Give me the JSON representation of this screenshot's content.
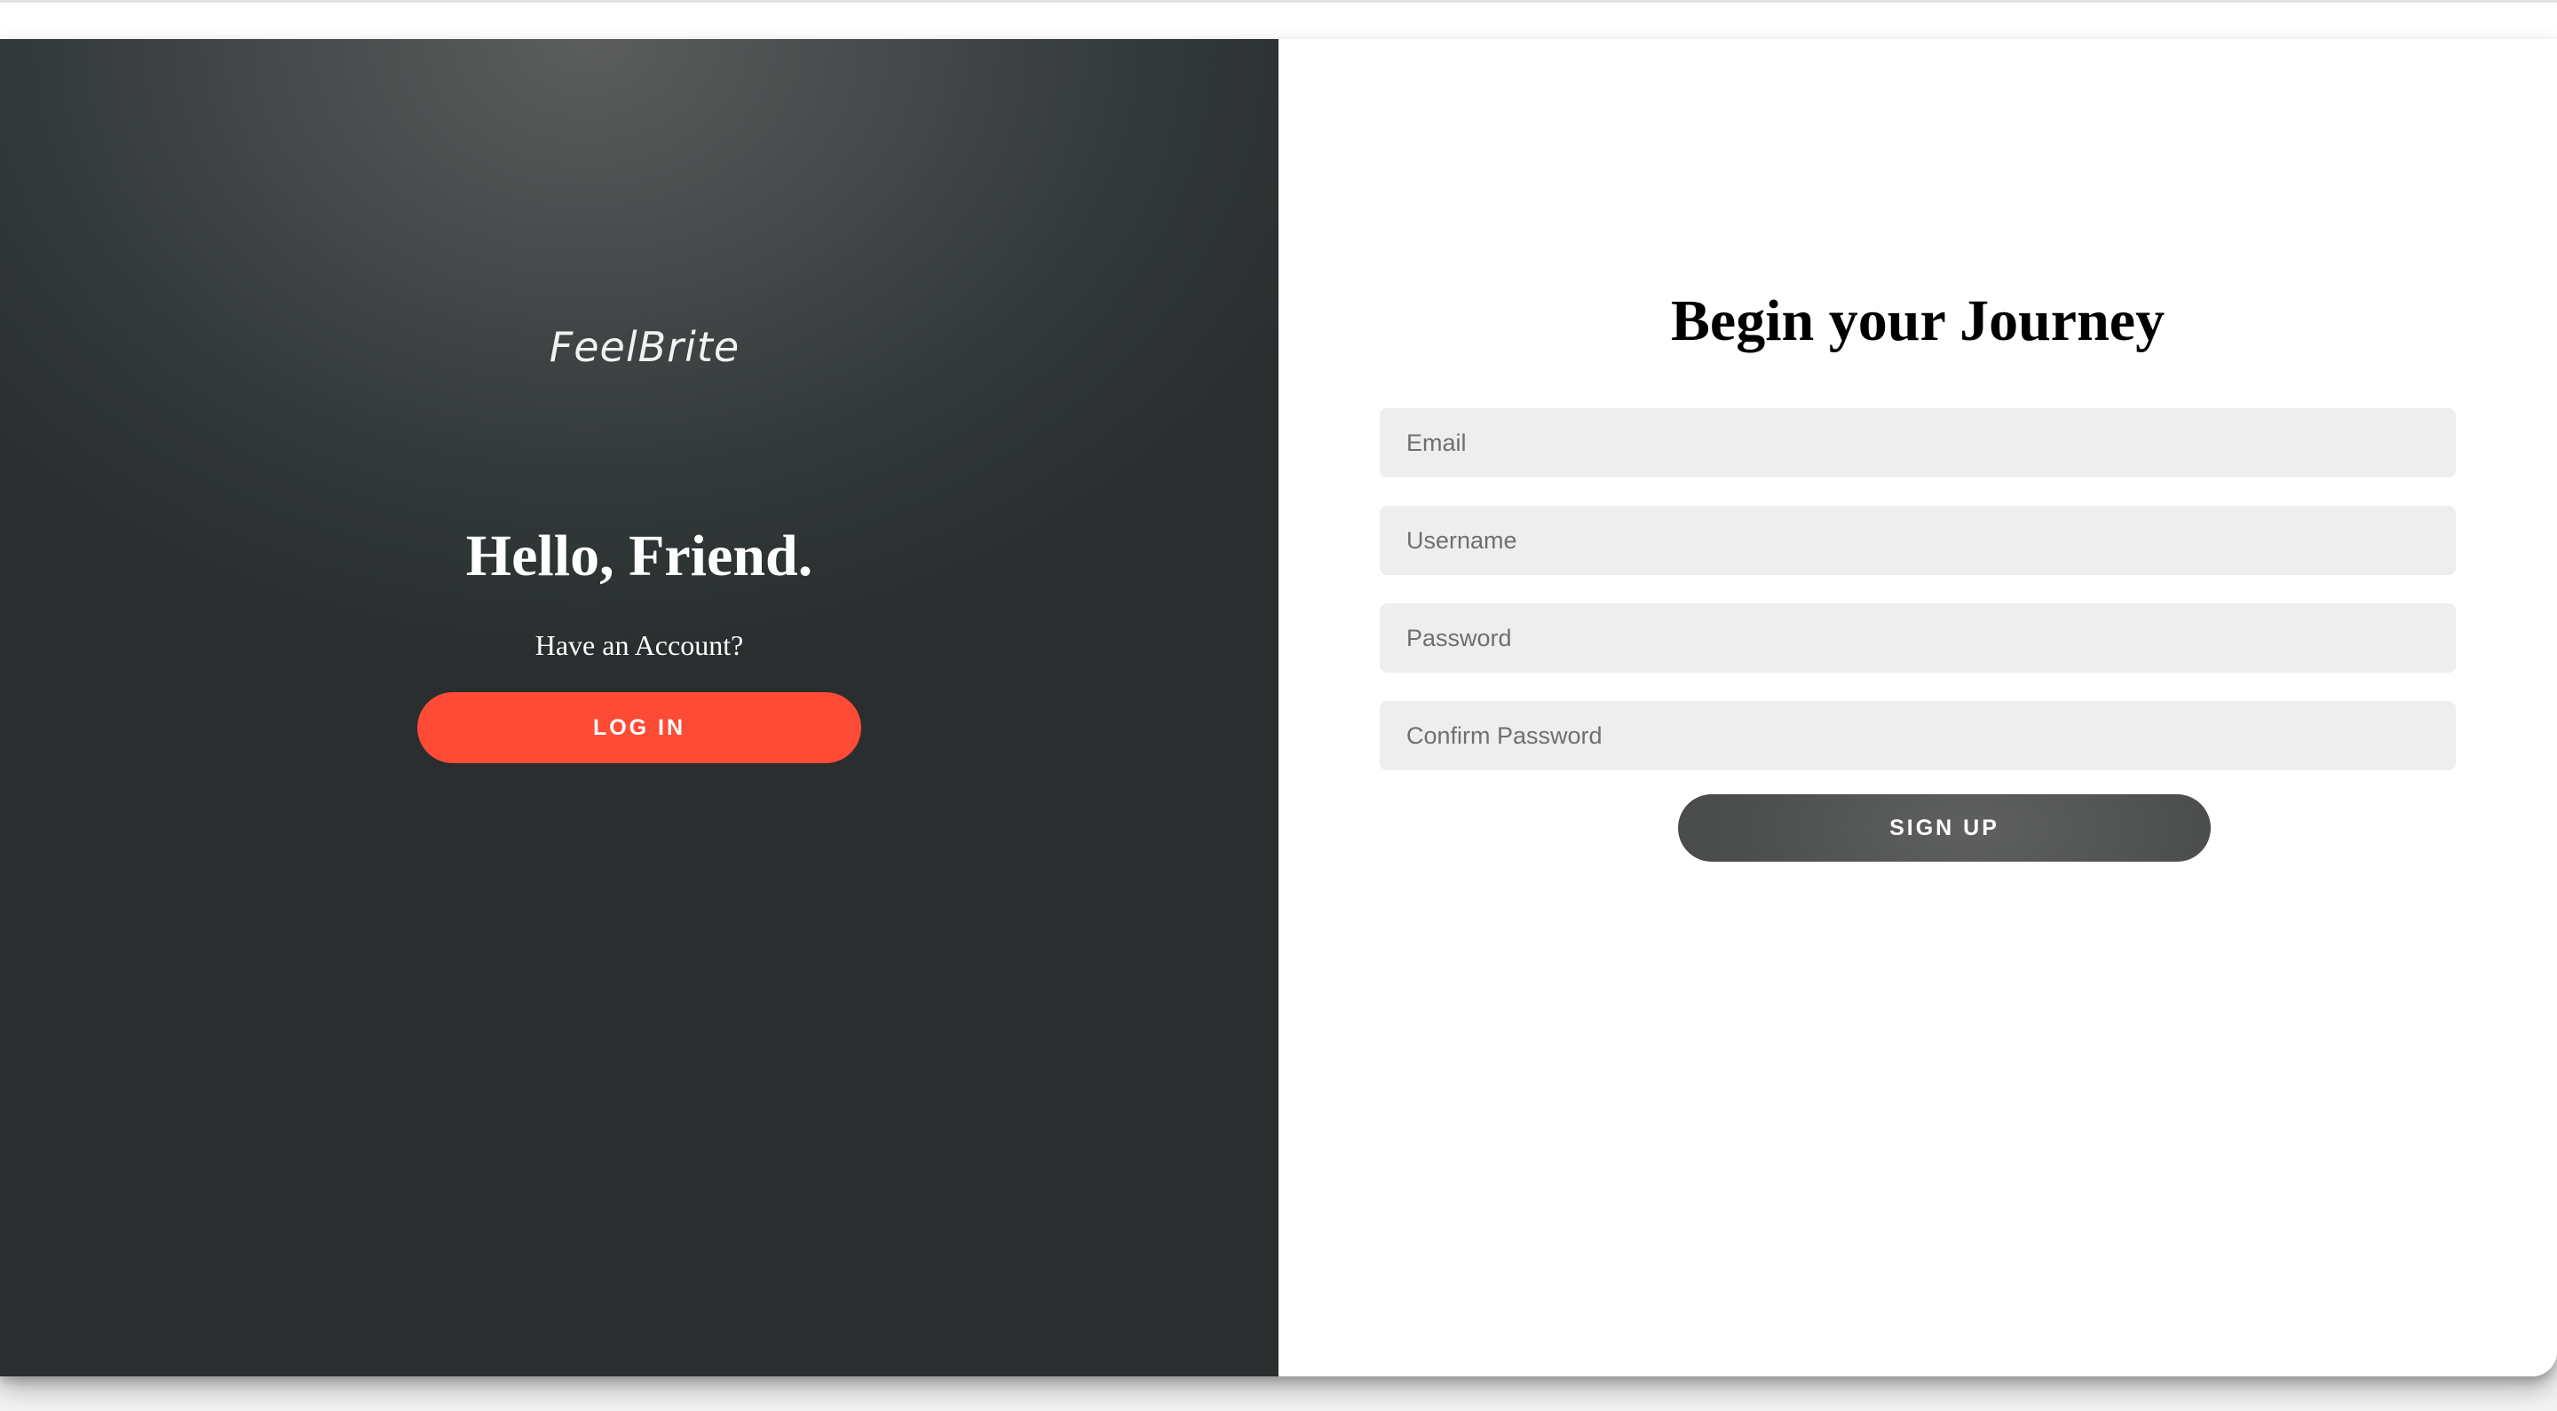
{
  "brand": {
    "logo_text": "FeelBrite"
  },
  "overlay": {
    "heading": "Hello, Friend.",
    "subtext": "Have an Account?",
    "login_label": "LOG IN"
  },
  "signup": {
    "title": "Begin your Journey",
    "email_placeholder": "Email",
    "username_placeholder": "Username",
    "password_placeholder": "Password",
    "confirm_password_placeholder": "Confirm Password",
    "signup_label": "SIGN UP"
  },
  "colors": {
    "accent": "#fe4b35",
    "panel_dark": "#2e3233",
    "input_bg": "#eeeeee",
    "button_dark": "#4f5151"
  }
}
